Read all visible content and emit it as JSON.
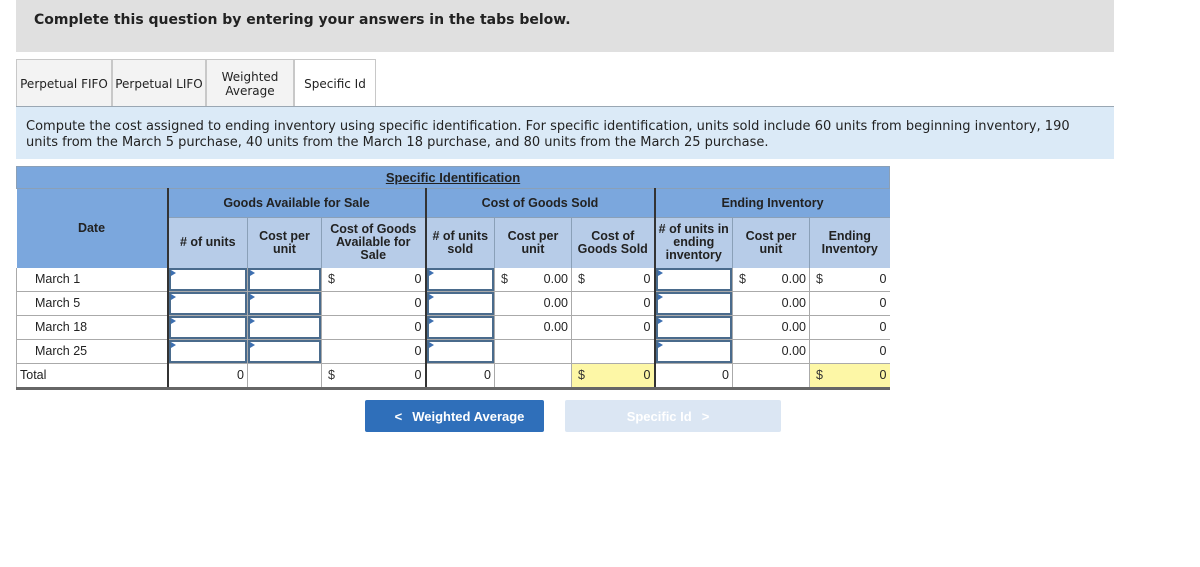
{
  "banner": {
    "text": "Complete this question by entering your answers in the tabs below."
  },
  "tabs": [
    {
      "label": "Perpetual FIFO",
      "active": false
    },
    {
      "label": "Perpetual LIFO",
      "active": false
    },
    {
      "label": "Weighted Average",
      "active": false
    },
    {
      "label": "Specific Id",
      "active": true
    }
  ],
  "instructions": "Compute the cost assigned to ending inventory using specific identification. For specific identification, units sold include 60 units from beginning inventory, 190 units from the March 5 purchase, 40 units from the March 18 purchase, and 80 units from the March 25 purchase.",
  "table": {
    "title": "Specific Identification",
    "groups": {
      "date": "Date",
      "available": "Goods Available for Sale",
      "cogs": "Cost of Goods Sold",
      "ending": "Ending Inventory"
    },
    "columns": {
      "units": "# of units",
      "cost_per_unit": "Cost per unit",
      "cogas": "Cost of Goods Available for Sale",
      "units_sold": "# of units sold",
      "cogs_cost_per_unit": "Cost per unit",
      "cogs": "Cost of Goods Sold",
      "units_ending": "# of units in ending inventory",
      "ei_cost_per_unit": "Cost per unit",
      "ending_inventory": "Ending Inventory"
    },
    "currency": "$",
    "rows": [
      {
        "date": "March 1",
        "cogas": "0",
        "cogs_cpu": "0.00",
        "cogs": "0",
        "ei_cpu": "0.00",
        "ei": "0"
      },
      {
        "date": "March 5",
        "cogas": "0",
        "cogs_cpu": "0.00",
        "cogs": "0",
        "ei_cpu": "0.00",
        "ei": "0"
      },
      {
        "date": "March 18",
        "cogas": "0",
        "cogs_cpu": "0.00",
        "cogs": "0",
        "ei_cpu": "0.00",
        "ei": "0"
      },
      {
        "date": "March 25",
        "cogas": "0",
        "cogs_cpu": "",
        "cogs": "",
        "ei_cpu": "0.00",
        "ei": "0"
      }
    ],
    "total": {
      "label": "Total",
      "units": "0",
      "cogas": "0",
      "units_sold": "0",
      "cogs": "0",
      "units_ending": "0",
      "ei": "0"
    }
  },
  "nav": {
    "prev_label": "Weighted Average",
    "next_label": "Specific Id",
    "prev_icon": "<",
    "next_icon": ">"
  }
}
